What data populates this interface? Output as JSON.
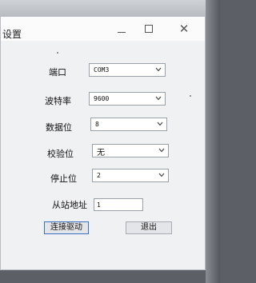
{
  "window": {
    "title": "设置"
  },
  "controls": {
    "minimize_icon": "minimize-icon",
    "maximize_icon": "maximize-icon",
    "close_icon": "close-icon"
  },
  "form": {
    "port": {
      "label": "端口",
      "value": "COM3"
    },
    "baud_rate": {
      "label": "波特率",
      "value": "9600"
    },
    "data_bits": {
      "label": "数据位",
      "value": "8"
    },
    "parity": {
      "label": "校验位",
      "value": "无"
    },
    "stop_bits": {
      "label": "停止位",
      "value": "2"
    },
    "slave_address": {
      "label": "从站地址",
      "value": "1"
    }
  },
  "buttons": {
    "connect": "连接驱动",
    "exit": "退出"
  },
  "colors": {
    "focus_border": "#3a6fc4",
    "window_bg": "#f0f1f3"
  }
}
